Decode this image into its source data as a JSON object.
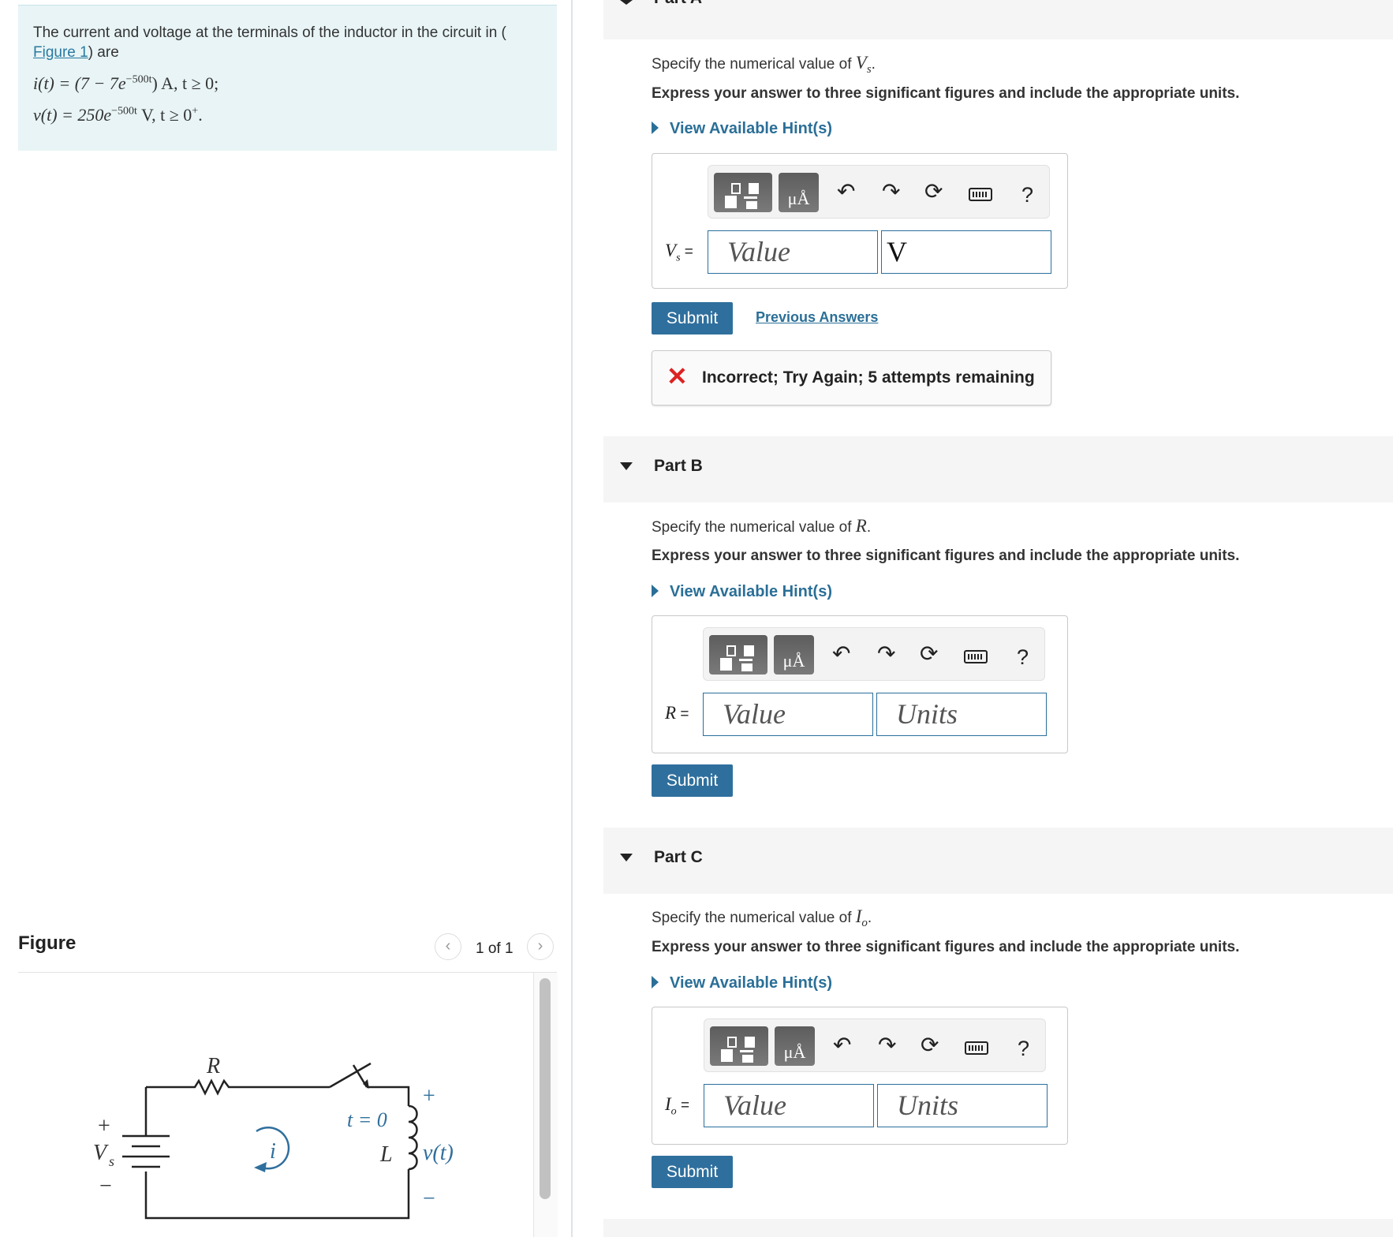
{
  "problem": {
    "intro_before_link": "The current and voltage at the terminals of the inductor in the circuit in (",
    "figure_link": "Figure 1",
    "intro_after_link": ") are",
    "eq_i_lhs": "i(t) = (7 − 7e",
    "eq_i_exp": "−500t",
    "eq_i_rhs": ") A, t ≥ 0;",
    "eq_v_lhs": "v(t) = 250e",
    "eq_v_exp": "−500t",
    "eq_v_rhs": " V, t ≥ 0",
    "eq_v_sup": "+",
    "eq_v_end": "."
  },
  "figure": {
    "title": "Figure",
    "pager": "1 of 1",
    "prev_icon": "chevron-left-icon",
    "next_icon": "chevron-right-icon",
    "labels": {
      "R": "R",
      "i": "i",
      "t0": "t = 0",
      "L": "L",
      "v": "v(t)",
      "Vs": "V",
      "Vs_sub": "s",
      "plus": "+",
      "minus": "−",
      "plus2": "+",
      "minus2": "−"
    }
  },
  "partA": {
    "label": "Part A",
    "spec_text": "Specify the numerical value of ",
    "spec_var": "V",
    "spec_var_sub": "s",
    "spec_end": ".",
    "express": "Express your answer to three significant figures and include the appropriate units.",
    "hint": "View Available Hint(s)",
    "var_label": "V",
    "var_sub": "s",
    "equals": " =",
    "value_placeholder": "Value",
    "units_value": "V",
    "submit": "Submit",
    "previous_answers": "Previous Answers",
    "feedback": "Incorrect; Try Again; 5 attempts remaining"
  },
  "partB": {
    "label": "Part B",
    "spec_text": "Specify the numerical value of ",
    "spec_var": "R",
    "spec_end": ".",
    "express": "Express your answer to three significant figures and include the appropriate units.",
    "hint": "View Available Hint(s)",
    "var_label": "R",
    "equals": " =",
    "value_placeholder": "Value",
    "units_placeholder": "Units",
    "submit": "Submit"
  },
  "partC": {
    "label": "Part C",
    "spec_text": "Specify the numerical value of ",
    "spec_var": "I",
    "spec_var_sub": "o",
    "spec_end": ".",
    "express": "Express your answer to three significant figures and include the appropriate units.",
    "hint": "View Available Hint(s)",
    "var_label": "I",
    "var_sub": "o",
    "equals": " =",
    "value_placeholder": "Value",
    "units_placeholder": "Units",
    "submit": "Submit"
  },
  "toolbar": {
    "units_button_text": "μÅ",
    "help": "?",
    "icons": [
      "templates-icon",
      "units-icon",
      "undo-icon",
      "redo-icon",
      "reset-icon",
      "keyboard-icon",
      "help-icon"
    ]
  },
  "colors": {
    "accent": "#2f6f9d",
    "link": "#2a7aa0",
    "problem_bg": "#e8f4f6",
    "error": "#dd2222"
  }
}
